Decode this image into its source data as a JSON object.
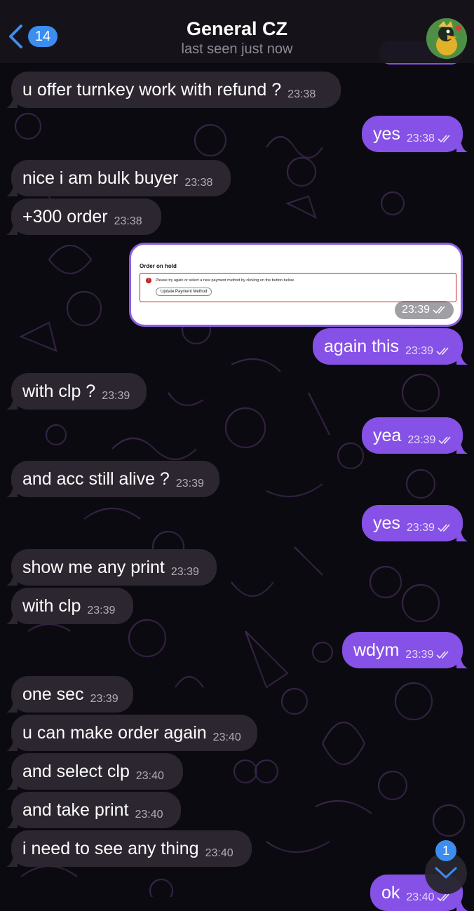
{
  "header": {
    "back_count": "14",
    "title": "General CZ",
    "subtitle": "last seen just now"
  },
  "image_message": {
    "heading": "Order on hold",
    "alert_text": "Please try again or select a new payment method by clicking on the button below.",
    "button_label": "Update Payment Method",
    "time": "23:39"
  },
  "messages": [
    {
      "dir": "in",
      "text": "u offer turnkey work with refund ?",
      "time": "23:38"
    },
    {
      "dir": "out",
      "text": "yes",
      "time": "23:38"
    },
    {
      "dir": "in",
      "text": "nice i am bulk buyer",
      "time": "23:38"
    },
    {
      "dir": "in",
      "text": "+300 order",
      "time": "23:38"
    },
    {
      "dir": "out",
      "text": "again this",
      "time": "23:39"
    },
    {
      "dir": "in",
      "text": "with clp ?",
      "time": "23:39"
    },
    {
      "dir": "out",
      "text": "yea",
      "time": "23:39"
    },
    {
      "dir": "in",
      "text": "and acc still alive ?",
      "time": "23:39"
    },
    {
      "dir": "out",
      "text": "yes",
      "time": "23:39"
    },
    {
      "dir": "in",
      "text": "show me any print",
      "time": "23:39"
    },
    {
      "dir": "in",
      "text": "with clp",
      "time": "23:39"
    },
    {
      "dir": "out",
      "text": "wdym",
      "time": "23:39"
    },
    {
      "dir": "in",
      "text": "one sec",
      "time": "23:39"
    },
    {
      "dir": "in",
      "text": "u can make order again",
      "time": "23:40"
    },
    {
      "dir": "in",
      "text": "and select clp",
      "time": "23:40"
    },
    {
      "dir": "in",
      "text": "and take print",
      "time": "23:40"
    },
    {
      "dir": "in",
      "text": "i need to see any thing",
      "time": "23:40"
    },
    {
      "dir": "out",
      "text": "ok",
      "time": "23:40"
    }
  ],
  "scroll_badge": "1",
  "colors": {
    "incoming_bubble": "#2c2630",
    "outgoing_bubble": "#8651e6",
    "accent": "#3b8df0",
    "background": "#0b0a10"
  },
  "icons": [
    "back-chevron-icon",
    "double-check-icon",
    "chevron-down-icon"
  ]
}
